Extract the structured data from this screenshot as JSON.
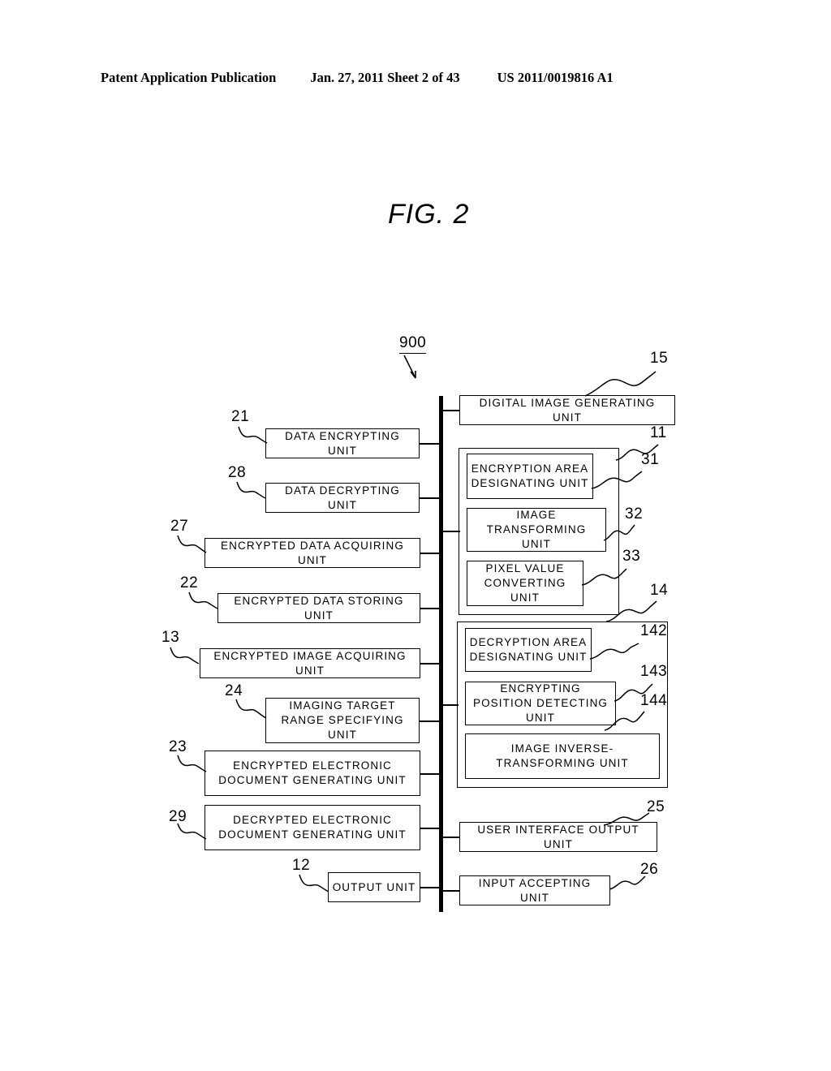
{
  "header": {
    "left": "Patent Application Publication",
    "middle": "Jan. 27, 2011  Sheet 2 of 43",
    "right": "US 2011/0019816 A1"
  },
  "figure": {
    "title": "FIG. 2",
    "system_ref": "900"
  },
  "diagram": {
    "right_column": {
      "digital_image_generating_unit": {
        "label": "DIGITAL IMAGE GENERATING UNIT",
        "ref": "15"
      },
      "encryption_group": {
        "ref": "11",
        "children": [
          {
            "label": "ENCRYPTION AREA DESIGNATING UNIT",
            "ref": "31"
          },
          {
            "label": "IMAGE TRANSFORMING UNIT",
            "ref": "32"
          },
          {
            "label": "PIXEL VALUE CONVERTING UNIT",
            "ref": "33"
          }
        ]
      },
      "decryption_group": {
        "ref": "14",
        "children": [
          {
            "label": "DECRYPTION AREA DESIGNATING UNIT",
            "ref": "142"
          },
          {
            "label": "ENCRYPTING POSITION DETECTING UNIT",
            "ref": "143"
          },
          {
            "label": "IMAGE INVERSE-TRANSFORMING UNIT",
            "ref": "144"
          }
        ]
      },
      "user_interface_output_unit": {
        "label": "USER INTERFACE OUTPUT UNIT",
        "ref": "25"
      },
      "input_accepting_unit": {
        "label": "INPUT ACCEPTING UNIT",
        "ref": "26"
      }
    },
    "left_column": [
      {
        "label": "DATA ENCRYPTING UNIT",
        "ref": "21"
      },
      {
        "label": "DATA DECRYPTING UNIT",
        "ref": "28"
      },
      {
        "label": "ENCRYPTED DATA ACQUIRING UNIT",
        "ref": "27"
      },
      {
        "label": "ENCRYPTED DATA STORING UNIT",
        "ref": "22"
      },
      {
        "label": "ENCRYPTED IMAGE ACQUIRING UNIT",
        "ref": "13"
      },
      {
        "label": "IMAGING TARGET RANGE SPECIFYING UNIT",
        "ref": "24"
      },
      {
        "label": "ENCRYPTED ELECTRONIC DOCUMENT GENERATING UNIT",
        "ref": "23"
      },
      {
        "label": "DECRYPTED ELECTRONIC DOCUMENT GENERATING UNIT",
        "ref": "29"
      },
      {
        "label": "OUTPUT UNIT",
        "ref": "12"
      }
    ]
  }
}
